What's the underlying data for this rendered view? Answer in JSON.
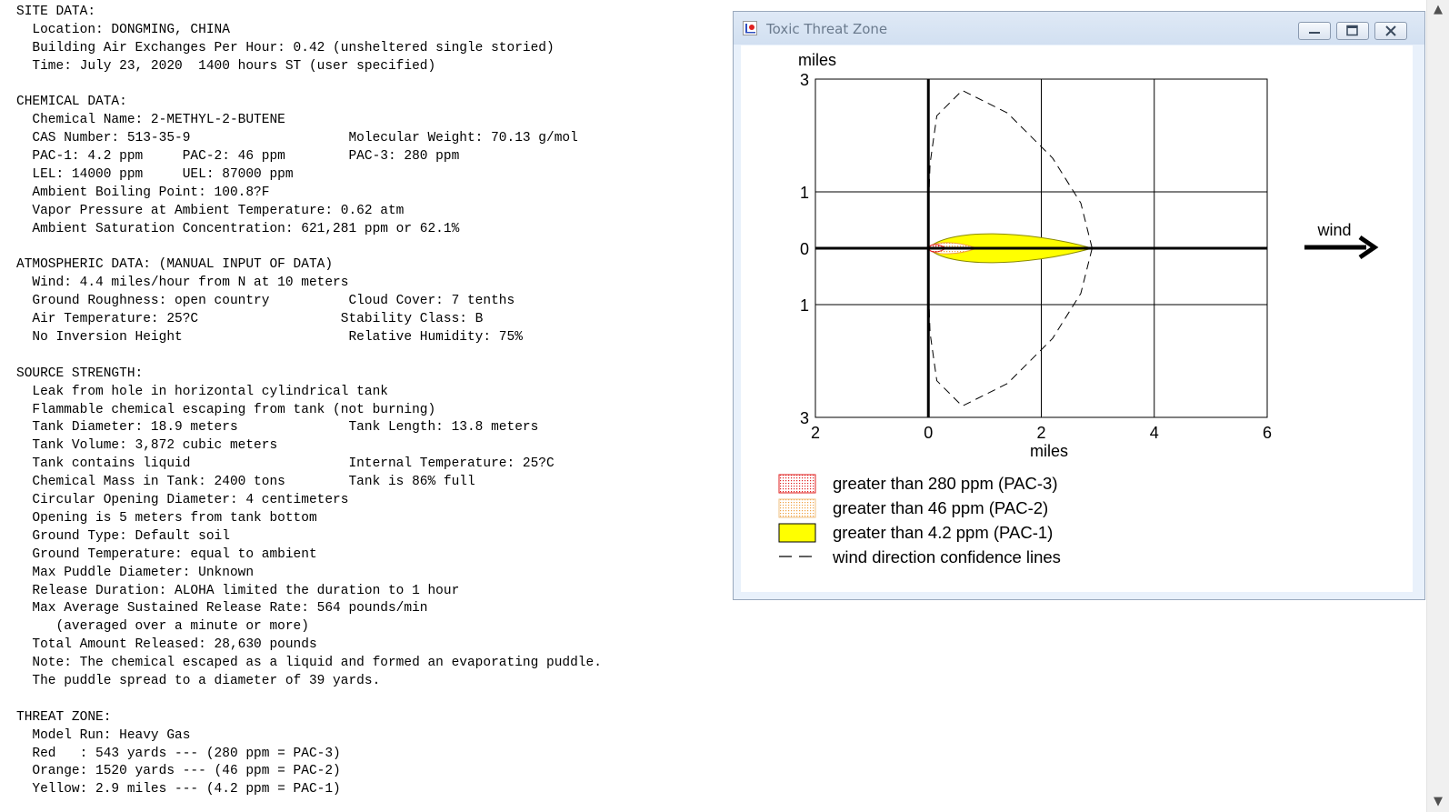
{
  "report": {
    "lines": [
      "SITE DATA:",
      "  Location: DONGMING, CHINA",
      "  Building Air Exchanges Per Hour: 0.42 (unsheltered single storied)",
      "  Time: July 23, 2020  1400 hours ST (user specified)",
      "",
      "CHEMICAL DATA:",
      "  Chemical Name: 2-METHYL-2-BUTENE",
      "  CAS Number: 513-35-9                    Molecular Weight: 70.13 g/mol",
      "  PAC-1: 4.2 ppm     PAC-2: 46 ppm        PAC-3: 280 ppm",
      "  LEL: 14000 ppm     UEL: 87000 ppm",
      "  Ambient Boiling Point: 100.8?F",
      "  Vapor Pressure at Ambient Temperature: 0.62 atm",
      "  Ambient Saturation Concentration: 621,281 ppm or 62.1%",
      "",
      "ATMOSPHERIC DATA: (MANUAL INPUT OF DATA)",
      "  Wind: 4.4 miles/hour from N at 10 meters",
      "  Ground Roughness: open country          Cloud Cover: 7 tenths",
      "  Air Temperature: 25?C                  Stability Class: B",
      "  No Inversion Height                     Relative Humidity: 75%",
      "",
      "SOURCE STRENGTH:",
      "  Leak from hole in horizontal cylindrical tank",
      "  Flammable chemical escaping from tank (not burning)",
      "  Tank Diameter: 18.9 meters              Tank Length: 13.8 meters",
      "  Tank Volume: 3,872 cubic meters",
      "  Tank contains liquid                    Internal Temperature: 25?C",
      "  Chemical Mass in Tank: 2400 tons        Tank is 86% full",
      "  Circular Opening Diameter: 4 centimeters",
      "  Opening is 5 meters from tank bottom",
      "  Ground Type: Default soil",
      "  Ground Temperature: equal to ambient",
      "  Max Puddle Diameter: Unknown",
      "  Release Duration: ALOHA limited the duration to 1 hour",
      "  Max Average Sustained Release Rate: 564 pounds/min",
      "     (averaged over a minute or more)",
      "  Total Amount Released: 28,630 pounds",
      "  Note: The chemical escaped as a liquid and formed an evaporating puddle.",
      "  The puddle spread to a diameter of 39 yards.",
      "",
      "THREAT ZONE:",
      "  Model Run: Heavy Gas",
      "  Red   : 543 yards --- (280 ppm = PAC-3)",
      "  Orange: 1520 yards --- (46 ppm = PAC-2)",
      "  Yellow: 2.9 miles --- (4.2 ppm = PAC-1)"
    ]
  },
  "window": {
    "title": "Toxic Threat Zone",
    "icons": {
      "app": "aloha-app-icon",
      "minimize": "minimize-icon",
      "maximize": "maximize-icon",
      "close": "close-icon"
    }
  },
  "scrollbar": {
    "up_icon": "▲",
    "down_icon": "▼"
  },
  "chart_data": {
    "type": "area",
    "xlabel": "miles",
    "ylabel": "miles",
    "xlim": [
      -2,
      6
    ],
    "ylim": [
      -3,
      3
    ],
    "x_ticks": [
      -2,
      0,
      2,
      4,
      6
    ],
    "y_ticks": [
      -3,
      -1,
      0,
      1,
      3
    ],
    "x_tick_labels": [
      "2",
      "0",
      "2",
      "4",
      "6"
    ],
    "y_tick_labels": [
      "3",
      "1",
      "0",
      "1",
      "3"
    ],
    "grid": true,
    "wind_label": "wind",
    "zones": [
      {
        "name": "greater than 280 ppm (PAC-3)",
        "level": "PAC-3",
        "length_miles": 0.31,
        "half_width_miles": 0.08,
        "color": "#e02020",
        "pattern": "dots"
      },
      {
        "name": "greater than 46 ppm (PAC-2)",
        "level": "PAC-2",
        "length_miles": 0.86,
        "half_width_miles": 0.12,
        "color": "#f0a040",
        "pattern": "dots"
      },
      {
        "name": "greater than 4.2 ppm (PAC-1)",
        "level": "PAC-1",
        "length_miles": 2.9,
        "half_width_miles": 0.31,
        "color": "#ffff00",
        "pattern": "solid"
      }
    ],
    "confidence_lines": {
      "name": "wind direction confidence lines",
      "radius_miles": 2.9,
      "upper": [
        [
          0.0,
          0.6
        ],
        [
          0.03,
          1.5
        ],
        [
          0.15,
          2.35
        ],
        [
          0.6,
          2.8
        ],
        [
          1.4,
          2.4
        ],
        [
          2.2,
          1.6
        ],
        [
          2.7,
          0.8
        ],
        [
          2.9,
          0.0
        ]
      ],
      "lower": [
        [
          0.0,
          -0.6
        ],
        [
          0.03,
          -1.5
        ],
        [
          0.15,
          -2.35
        ],
        [
          0.6,
          -2.8
        ],
        [
          1.4,
          -2.4
        ],
        [
          2.2,
          -1.6
        ],
        [
          2.7,
          -0.8
        ],
        [
          2.9,
          0.0
        ]
      ]
    },
    "legend": [
      {
        "label": "greater than 280 ppm (PAC-3)",
        "swatch": "pac3-dotted"
      },
      {
        "label": "greater than 46 ppm (PAC-2)",
        "swatch": "pac2-dotted"
      },
      {
        "label": "greater than 4.2 ppm (PAC-1)",
        "swatch": "pac1-solid"
      },
      {
        "label": "wind direction confidence lines",
        "swatch": "dashed"
      }
    ]
  }
}
